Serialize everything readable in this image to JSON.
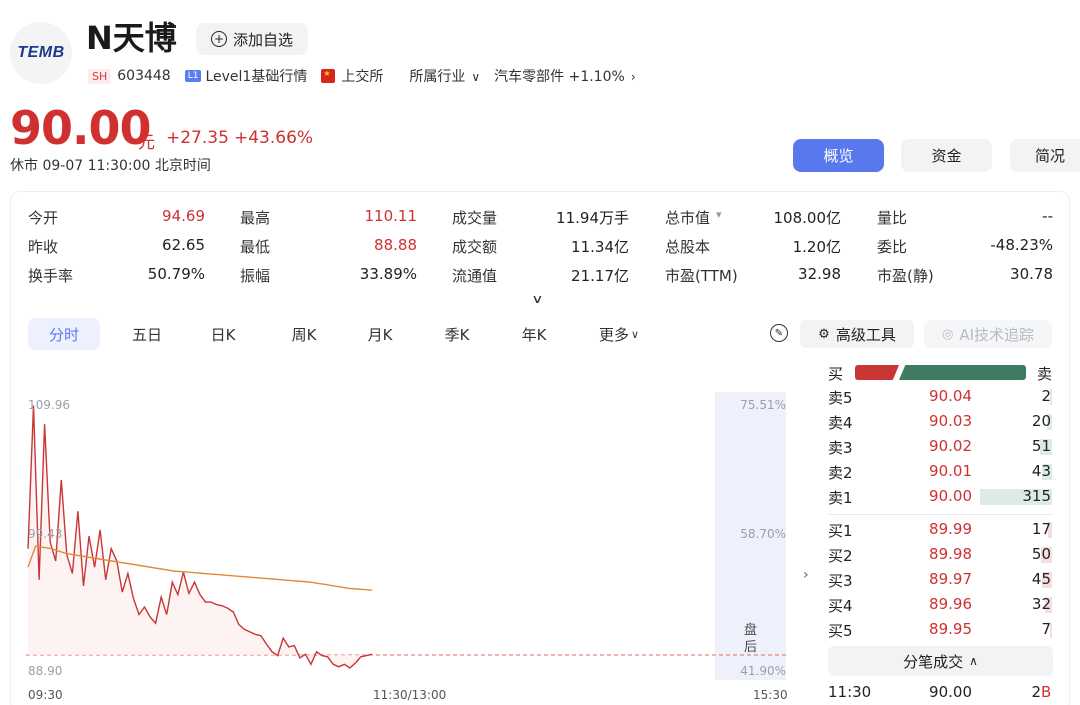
{
  "stock": {
    "logo_text": "TEMB",
    "name": "N天博",
    "add_watch_label": "添加自选",
    "market_tag": "SH",
    "code": "603448",
    "level_tag": "L1",
    "level_text": "Level1基础行情",
    "exchange": "上交所",
    "industry_label": "所属行业",
    "industry_name": "汽车零部件",
    "industry_change": "+1.10%",
    "price": "90.00",
    "unit": "元",
    "change": "+27.35",
    "change_pct": "+43.66%",
    "status": "休市 09-07 11:30:00 北京时间"
  },
  "colors": {
    "up": "#d03030",
    "down": "#3d7c63",
    "accent": "#5a78ee"
  },
  "view_tabs": [
    "概览",
    "资金",
    "简况"
  ],
  "stats": [
    [
      {
        "label": "今开",
        "value": "94.69",
        "tone": "up"
      },
      {
        "label": "最高",
        "value": "110.11",
        "tone": "up"
      },
      {
        "label": "成交量",
        "value": "11.94万手",
        "tone": ""
      },
      {
        "label": "总市值",
        "value": "108.00亿",
        "tone": ""
      },
      {
        "label": "量比",
        "value": "--",
        "tone": ""
      }
    ],
    [
      {
        "label": "昨收",
        "value": "62.65",
        "tone": ""
      },
      {
        "label": "最低",
        "value": "88.88",
        "tone": "up"
      },
      {
        "label": "成交额",
        "value": "11.34亿",
        "tone": ""
      },
      {
        "label": "总股本",
        "value": "1.20亿",
        "tone": ""
      },
      {
        "label": "委比",
        "value": "-48.23%",
        "tone": ""
      }
    ],
    [
      {
        "label": "换手率",
        "value": "50.79%",
        "tone": ""
      },
      {
        "label": "振幅",
        "value": "33.89%",
        "tone": ""
      },
      {
        "label": "流通值",
        "value": "21.17亿",
        "tone": ""
      },
      {
        "label": "市盈(TTM)",
        "value": "32.98",
        "tone": ""
      },
      {
        "label": "市盈(静)",
        "value": "30.78",
        "tone": ""
      }
    ]
  ],
  "period_tabs": [
    "分时",
    "五日",
    "日K",
    "周K",
    "月K",
    "季K",
    "年K",
    "更多"
  ],
  "tools": {
    "advanced": "高级工具",
    "ai": "AI技术追踪"
  },
  "chart_labels": {
    "y_top": "109.96",
    "y_mid": "99.43",
    "y_bottom": "88.90",
    "pct_top": "75.51%",
    "pct_mid": "58.70%",
    "pct_bottom": "41.90%",
    "x_start": "09:30",
    "x_mid": "11:30/13:00",
    "x_end": "15:30",
    "after_hours": "盘后"
  },
  "chart_data": {
    "type": "line",
    "ylim": [
      88.9,
      109.96
    ],
    "x_range": [
      "09:30",
      "15:30"
    ],
    "series": [
      {
        "values": [
          98.5,
          110.0,
          96.0,
          108.5,
          99.0,
          97.5,
          104.0,
          98.0,
          96.5,
          101.5,
          95.5,
          99.5,
          97.0,
          100.0,
          96.0,
          98.5,
          97.5,
          95.0,
          96.5,
          94.5,
          93.2,
          93.8,
          93.0,
          92.5,
          94.6,
          93.2,
          95.8,
          94.8,
          96.6,
          94.9,
          95.8,
          94.8,
          94.2,
          94.2,
          94.0,
          93.9,
          93.7,
          93.4,
          92.4,
          92.0,
          91.8,
          91.6,
          91.5,
          90.8,
          90.2,
          89.9,
          91.3,
          90.6,
          90.7,
          89.7,
          90.0,
          89.2,
          90.2,
          89.9,
          89.8,
          89.2,
          89.0,
          89.2,
          88.9,
          89.3,
          89.8,
          89.9,
          90.0
        ]
      },
      {
        "values": [
          97.0,
          98.7,
          98.6,
          98.5,
          98.3,
          98.1,
          98.0,
          97.9,
          97.8,
          97.7,
          97.6,
          97.5,
          97.4,
          97.3,
          97.2,
          97.1,
          97.0,
          96.9,
          96.8,
          96.7,
          96.65,
          96.6,
          96.55,
          96.5,
          96.45,
          96.4,
          96.35,
          96.3,
          96.25,
          96.2,
          96.15,
          96.1,
          96.05,
          96.0,
          95.95,
          95.9,
          95.85,
          95.8,
          95.7,
          95.6,
          95.5,
          95.4,
          95.3,
          95.25,
          95.2,
          95.15
        ]
      }
    ]
  },
  "order_book": {
    "buy_label": "买",
    "sell_label": "卖",
    "buy_ratio": 0.26,
    "asks": [
      {
        "label": "卖5",
        "price": "90.04",
        "vol": "2"
      },
      {
        "label": "卖4",
        "price": "90.03",
        "vol": "20"
      },
      {
        "label": "卖3",
        "price": "90.02",
        "vol": "51"
      },
      {
        "label": "卖2",
        "price": "90.01",
        "vol": "43"
      },
      {
        "label": "卖1",
        "price": "90.00",
        "vol": "315"
      }
    ],
    "bids": [
      {
        "label": "买1",
        "price": "89.99",
        "vol": "17"
      },
      {
        "label": "买2",
        "price": "89.98",
        "vol": "50"
      },
      {
        "label": "买3",
        "price": "89.97",
        "vol": "45"
      },
      {
        "label": "买4",
        "price": "89.96",
        "vol": "32"
      },
      {
        "label": "买5",
        "price": "89.95",
        "vol": "7"
      }
    ],
    "tick_label": "分笔成交",
    "ticks": [
      {
        "time": "11:30",
        "price": "90.00",
        "vol": "2",
        "side": "B"
      }
    ]
  }
}
